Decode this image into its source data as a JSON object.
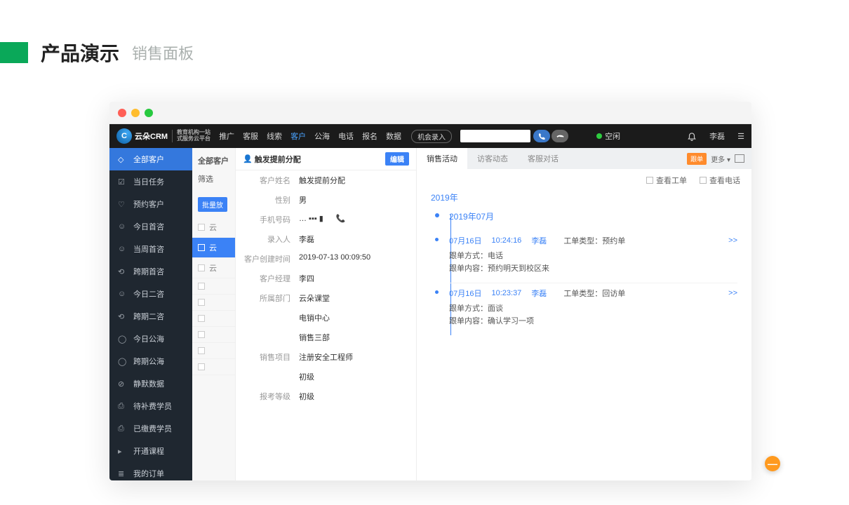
{
  "header": {
    "title": "产品演示",
    "subtitle": "销售面板"
  },
  "logo": {
    "text": "云朵CRM",
    "sub1": "教育机构一站",
    "sub2": "式服务云平台"
  },
  "topnav": [
    "推广",
    "客服",
    "线索",
    "客户",
    "公海",
    "电话",
    "报名",
    "数据"
  ],
  "topnav_active": 3,
  "pill": "机会录入",
  "status_text": "空闲",
  "user_name": "李磊",
  "sidebar": [
    "全部客户",
    "当日任务",
    "预约客户",
    "今日首咨",
    "当周首咨",
    "跨期首咨",
    "今日二咨",
    "跨期二咨",
    "今日公海",
    "跨期公海",
    "静默数据",
    "待补费学员",
    "已缴费学员",
    "开通课程",
    "我的订单"
  ],
  "sidebar_active": 0,
  "mid": {
    "head": "全部客户",
    "filter": "筛选",
    "tag": "批量放",
    "rows": [
      "云",
      "云",
      "云",
      "",
      "",
      "",
      "",
      "",
      ""
    ]
  },
  "detail": {
    "title": "触发提前分配",
    "edit": "编辑",
    "fields": [
      {
        "label": "客户姓名",
        "value": "触发提前分配"
      },
      {
        "label": "性别",
        "value": "男"
      },
      {
        "label": "手机号码",
        "value": "… ▪▪▪ ▮",
        "phone": true
      },
      {
        "label": "录入人",
        "value": "李磊"
      },
      {
        "label": "客户创建时间",
        "value": "2019-07-13 00:09:50"
      },
      {
        "label": "客户经理",
        "value": "李四"
      },
      {
        "label": "所属部门",
        "value": "云朵课堂"
      },
      {
        "label": "",
        "value": "电销中心"
      },
      {
        "label": "",
        "value": "销售三部"
      },
      {
        "label": "销售项目",
        "value": "注册安全工程师"
      },
      {
        "label": "",
        "value": "初级"
      },
      {
        "label": "报考等级",
        "value": "初级"
      }
    ]
  },
  "right": {
    "tabs": [
      "销售活动",
      "访客动态",
      "客服对话"
    ],
    "tab_active": 0,
    "badge": "跟单",
    "more": "更多 ▾",
    "checks": [
      "查看工单",
      "查看电话"
    ],
    "year": "2019年",
    "month": "2019年07月",
    "entries": [
      {
        "date": "07月16日",
        "time": "10:24:16",
        "user": "李磊",
        "type_label": "工单类型：",
        "type": "预约单",
        "method_label": "跟单方式：",
        "method": "电话",
        "content_label": "跟单内容：",
        "content": "预约明天到校区来",
        "arrow": ">>"
      },
      {
        "date": "07月16日",
        "time": "10:23:37",
        "user": "李磊",
        "type_label": "工单类型：",
        "type": "回访单",
        "method_label": "跟单方式：",
        "method": "面谈",
        "content_label": "跟单内容：",
        "content": "确认学习一项",
        "arrow": ">>"
      }
    ]
  }
}
